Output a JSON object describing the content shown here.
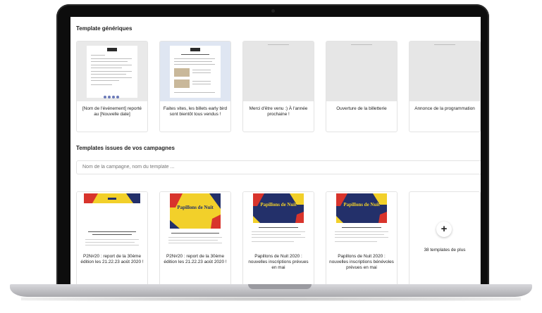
{
  "generic": {
    "title": "Template génériques",
    "cards": [
      {
        "label": "[Nom de l'événement] reporté au [Nouvelle date]"
      },
      {
        "label": "Faites vites, les billets early bird sont bientôt tous vendus !"
      },
      {
        "label": "Merci d'être venu :) À l'année prochaine !"
      },
      {
        "label": "Ouverture de la billetterie"
      },
      {
        "label": "Annonce de la programmation"
      }
    ]
  },
  "campaigns": {
    "title": "Templates issues de vos campagnes",
    "search_placeholder": "Nom de la campagne, nom du template ...",
    "poster_title": "Papillons de Nuit",
    "cards": [
      {
        "label": "P2N#20 : report de la 30ème édition les 21.22.23 août 2020 !"
      },
      {
        "label": "P2N#20 : report de la 30ème édition les 21.22.23 août 2020 !"
      },
      {
        "label": "Papillons de Nuit 2020 : nouvelles inscriptions prévues en mai"
      },
      {
        "label": "Papillons de Nuit 2020 : nouvelles inscriptions bénévoles prévues en mai"
      }
    ],
    "more_icon": "+",
    "more_label": "38 templates de plus"
  },
  "colors": {
    "poster_yellow": "#f2d02a",
    "poster_navy": "#23306a",
    "poster_red": "#d8342c",
    "doc_blue_bg": "#dfe6f2"
  },
  "icons": {
    "more": "plus-icon"
  }
}
